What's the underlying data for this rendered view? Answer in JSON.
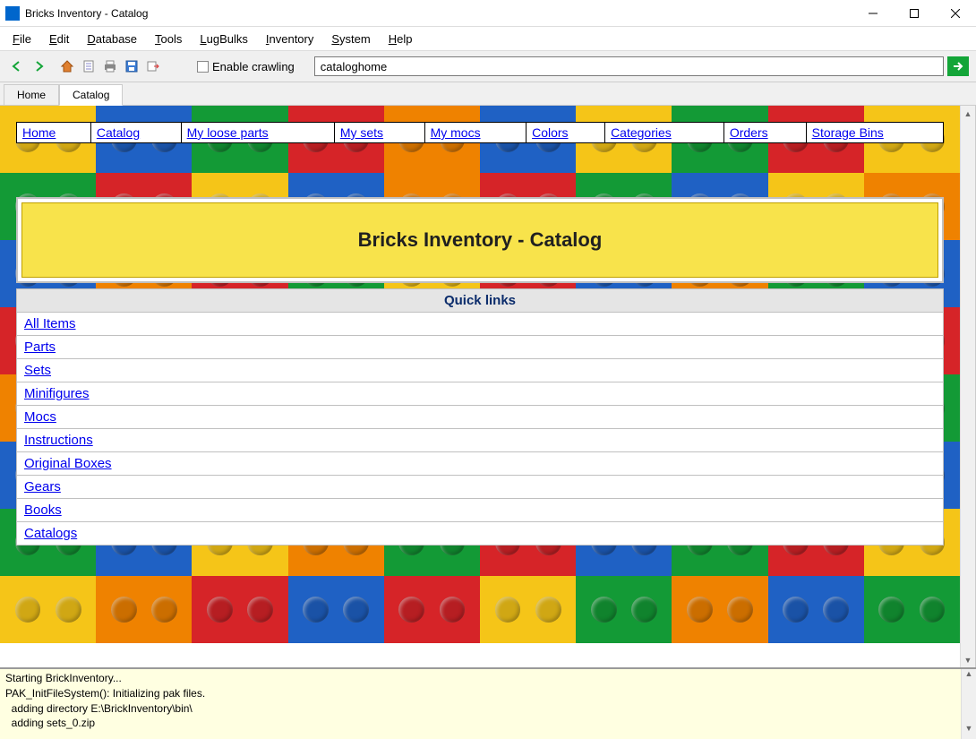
{
  "window": {
    "title": "Bricks Inventory - Catalog"
  },
  "menu": {
    "items": [
      "File",
      "Edit",
      "Database",
      "Tools",
      "LugBulks",
      "Inventory",
      "System",
      "Help"
    ]
  },
  "toolbar": {
    "crawl_label": "Enable crawling",
    "url_value": "cataloghome"
  },
  "tabs": {
    "items": [
      "Home",
      "Catalog"
    ],
    "active_index": 1
  },
  "nav_links": [
    "Home",
    "Catalog",
    "My loose parts",
    "My sets",
    "My mocs",
    "Colors",
    "Categories",
    "Orders",
    "Storage Bins"
  ],
  "page_title": "Bricks Inventory - Catalog",
  "quick_links_header": "Quick links",
  "quick_links": [
    "All Items",
    "Parts",
    "Sets",
    "Minifigures",
    "Mocs",
    "Instructions",
    "Original Boxes",
    "Gears",
    "Books",
    "Catalogs"
  ],
  "console_lines": [
    "Starting BrickInventory...",
    "PAK_InitFileSystem(): Initializing pak files.",
    "  adding directory E:\\BrickInventory\\bin\\",
    "  adding sets_0.zip"
  ],
  "lego_colors": [
    "c-yellow",
    "c-blue",
    "c-green",
    "c-red",
    "c-orange",
    "c-blue",
    "c-yellow",
    "c-green",
    "c-red",
    "c-yellow",
    "c-green",
    "c-red",
    "c-yellow",
    "c-blue",
    "c-orange",
    "c-red",
    "c-green",
    "c-blue",
    "c-yellow",
    "c-orange",
    "c-blue",
    "c-orange",
    "c-red",
    "c-green",
    "c-yellow",
    "c-red",
    "c-blue",
    "c-orange",
    "c-green",
    "c-blue",
    "c-red",
    "c-green",
    "c-blue",
    "c-yellow",
    "c-red",
    "c-orange",
    "c-yellow",
    "c-green",
    "c-blue",
    "c-red",
    "c-orange",
    "c-yellow",
    "c-green",
    "c-red",
    "c-blue",
    "c-green",
    "c-orange",
    "c-red",
    "c-yellow",
    "c-green",
    "c-blue",
    "c-red",
    "c-orange",
    "c-green",
    "c-yellow",
    "c-blue",
    "c-red",
    "c-yellow",
    "c-orange",
    "c-blue",
    "c-green",
    "c-blue",
    "c-yellow",
    "c-orange",
    "c-green",
    "c-red",
    "c-blue",
    "c-green",
    "c-red",
    "c-yellow",
    "c-yellow",
    "c-orange",
    "c-red",
    "c-blue",
    "c-red",
    "c-yellow",
    "c-green",
    "c-orange",
    "c-blue",
    "c-green"
  ]
}
